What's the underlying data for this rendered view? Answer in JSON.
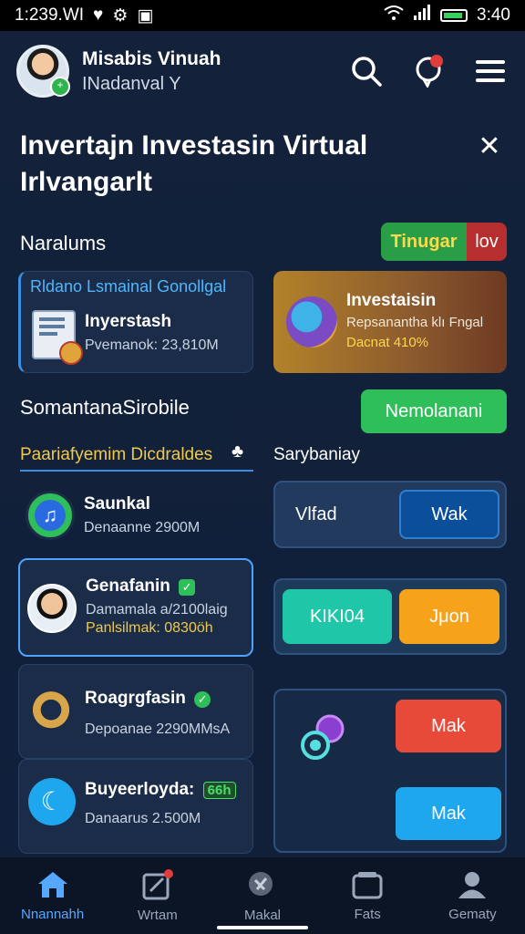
{
  "status_bar": {
    "time": "1:239.WI",
    "clock_right": "3:40"
  },
  "header": {
    "user_name": "Misabis Vinuah",
    "user_subtitle": "INadanval Y"
  },
  "page": {
    "title": "Invertajn Investasin Virtual Irlvangarlt",
    "section1_label": "Naralums",
    "toggle": {
      "seg1": "Tinugar",
      "seg2": "lov"
    },
    "card_left": {
      "header": "Rldano Lsmainal Gonollgal",
      "title": "Inyerstash",
      "sub": "Pvemanok: 23,810M"
    },
    "card_right": {
      "title": "Investaisin",
      "sub": "Repsanantha klı Fngal",
      "sub2": "Dacnat 410%"
    },
    "section2_label": "SomantanaSirobile",
    "section2_button": "Nemolanani",
    "tab_left": "Paariafyemim Dicdraldes",
    "tab_right": "Sarybaniay",
    "list": [
      {
        "title": "Saunkal",
        "sub": "Denaanne 2900M",
        "sub2": "",
        "badge": ""
      },
      {
        "title": "Genafanin",
        "sub": "Damamala а/2100lаig",
        "sub2": "Panlsilmak: 0830öh",
        "badge": ""
      },
      {
        "title": "Roagrgfasin",
        "sub": "Depoanae 2290MMsA",
        "sub2": "",
        "badge": ""
      },
      {
        "title": "Buyeerloyda:",
        "sub": "Danaarus 2.500M",
        "sub2": "",
        "badge": "66h"
      }
    ],
    "panel1": {
      "label": "Vlfad",
      "button": "Wak"
    },
    "panel2": {
      "button1": "KIKI04",
      "button2": "Jμon"
    },
    "panel3": {
      "button1": "Mak",
      "button2": "Mak"
    }
  },
  "bottom_nav": [
    {
      "label": "Nnannahh",
      "icon": "home-icon",
      "active": true
    },
    {
      "label": "Wrtam",
      "icon": "edit-icon",
      "active": false
    },
    {
      "label": "Makal",
      "icon": "search-icon",
      "active": false
    },
    {
      "label": "Fats",
      "icon": "wallet-icon",
      "active": false
    },
    {
      "label": "Gematy",
      "icon": "profile-icon",
      "active": false
    }
  ],
  "colors": {
    "accent_blue": "#4ea3ff",
    "green": "#2fbf5a",
    "red": "#e84a3a",
    "orange": "#f6a21a",
    "teal": "#1fc6a8",
    "sky": "#1ea6ef"
  }
}
